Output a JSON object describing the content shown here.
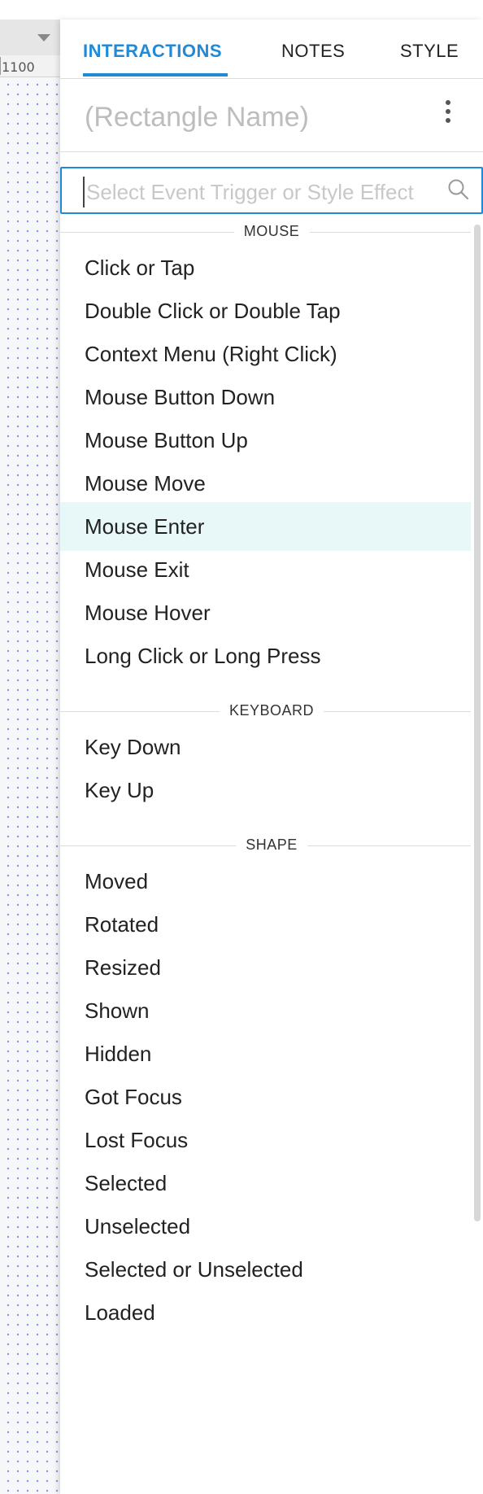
{
  "ruler": {
    "label": "1100"
  },
  "tabs": [
    {
      "label": "INTERACTIONS",
      "active": true
    },
    {
      "label": "NOTES",
      "active": false
    },
    {
      "label": "STYLE",
      "active": false
    }
  ],
  "element_name": "(Rectangle Name)",
  "search": {
    "placeholder": "Select Event Trigger or Style Effect",
    "value": ""
  },
  "sections": [
    {
      "title": "MOUSE",
      "items": [
        "Click or Tap",
        "Double Click or Double Tap",
        "Context Menu (Right Click)",
        "Mouse Button Down",
        "Mouse Button Up",
        "Mouse Move",
        "Mouse Enter",
        "Mouse Exit",
        "Mouse Hover",
        "Long Click or Long Press"
      ]
    },
    {
      "title": "KEYBOARD",
      "items": [
        "Key Down",
        "Key Up"
      ]
    },
    {
      "title": "SHAPE",
      "items": [
        "Moved",
        "Rotated",
        "Resized",
        "Shown",
        "Hidden",
        "Got Focus",
        "Lost Focus",
        "Selected",
        "Unselected",
        "Selected or Unselected",
        "Loaded"
      ]
    }
  ],
  "hovered_item": "Mouse Enter",
  "icons": {
    "search": "search-icon",
    "more": "more-vertical-icon",
    "dropdown": "chevron-down-icon"
  },
  "colors": {
    "accent": "#1f8ad8",
    "hover_bg": "#e8f8f8",
    "placeholder": "#c8c8c8",
    "dot_grid": "#8a8ff0"
  }
}
